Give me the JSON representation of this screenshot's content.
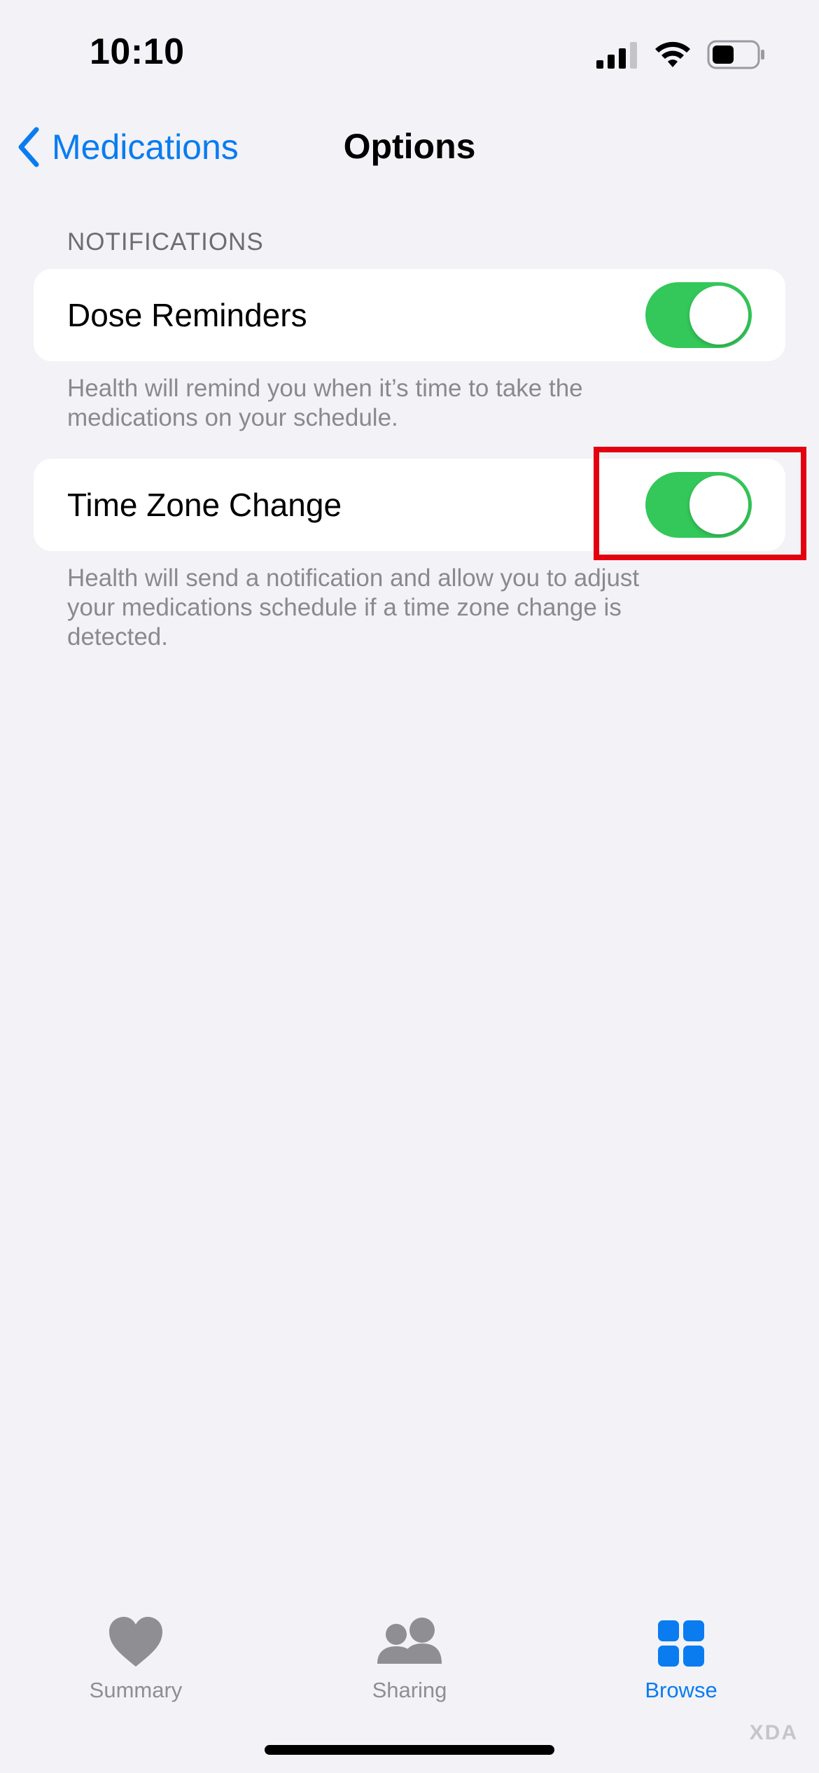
{
  "status_bar": {
    "time": "10:10",
    "icons": [
      "cellular-signal-icon",
      "wifi-icon",
      "battery-icon"
    ]
  },
  "nav": {
    "back_label": "Medications",
    "title": "Options"
  },
  "section": {
    "header": "NOTIFICATIONS",
    "items": [
      {
        "label": "Dose Reminders",
        "enabled": true,
        "footnote_line1": "Health will remind you when it’s time to take the",
        "footnote_line2": "medications on your schedule."
      },
      {
        "label": "Time Zone Change",
        "enabled": true,
        "footnote_line1": "Health will send a notification and allow you to adjust",
        "footnote_line2": "your medications schedule if a time zone change is",
        "footnote_line3": "detected."
      }
    ]
  },
  "tab_bar": {
    "tabs": [
      {
        "label": "Summary",
        "icon": "heart-icon",
        "active": false
      },
      {
        "label": "Sharing",
        "icon": "people-icon",
        "active": false
      },
      {
        "label": "Browse",
        "icon": "grid-icon",
        "active": true
      }
    ]
  },
  "watermark": "XDA",
  "colors": {
    "accent": "#0a7cf0",
    "toggle_on": "#34c759",
    "highlight": "#e3000f",
    "background": "#f2f2f7"
  }
}
